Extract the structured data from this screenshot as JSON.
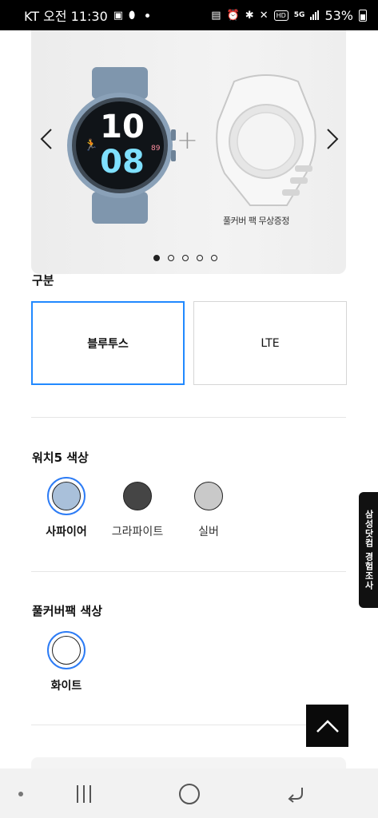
{
  "status_bar": {
    "carrier_time": "KT 오전 11:30",
    "battery": "53%"
  },
  "hero": {
    "watch_time_hour": "10",
    "watch_time_min": "08",
    "watch_small_num": "89",
    "caption": "풀커버 팩 무상증정",
    "slide_count": 5,
    "active_slide": 1
  },
  "connectivity": {
    "title": "구분",
    "options": [
      {
        "label": "블루투스",
        "selected": true
      },
      {
        "label": "LTE",
        "selected": false
      }
    ]
  },
  "watch_color": {
    "title": "워치5 색상",
    "options": [
      {
        "label": "사파이어",
        "color": "#a9c0da",
        "selected": true
      },
      {
        "label": "그라파이트",
        "color": "#454545",
        "selected": false
      },
      {
        "label": "실버",
        "color": "#c9c9c9",
        "selected": false
      }
    ]
  },
  "cover_color": {
    "title": "풀커버팩 색상",
    "options": [
      {
        "label": "화이트",
        "color": "#ffffff",
        "selected": true
      }
    ]
  },
  "survey_tab": {
    "label": "삼성닷컴 경험조사"
  },
  "colors": {
    "accent": "#2189ff",
    "selected_ring": "#2d7cf5"
  }
}
